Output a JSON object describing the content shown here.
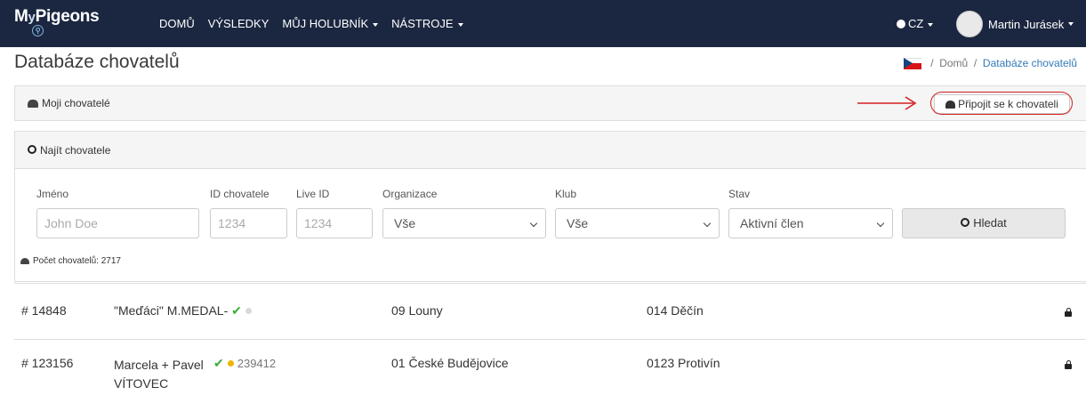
{
  "nav": {
    "logo": "MyPigeons",
    "logo_my": "M",
    "logo_y": "y",
    "logo_rest": "Pigeons",
    "items": [
      {
        "label": "DOMŮ"
      },
      {
        "label": "VÝSLEDKY"
      },
      {
        "label": "MŮJ HOLUBNÍK"
      },
      {
        "label": "NÁSTROJE"
      }
    ],
    "language": "CZ",
    "user": "Martin Jurásek"
  },
  "page": {
    "title": "Databáze chovatelů",
    "breadcrumb": [
      "Domů",
      "Databáze chovatelů"
    ],
    "breadcrumb_sep": "/"
  },
  "my_breeders": {
    "title": "Moji chovatelé",
    "join_button": "Připojit se k chovateli"
  },
  "search": {
    "title": "Najít chovatele",
    "fields": {
      "name": {
        "label": "Jméno",
        "placeholder": "John Doe"
      },
      "breeder_id": {
        "label": "ID chovatele",
        "placeholder": "1234"
      },
      "live_id": {
        "label": "Live ID",
        "placeholder": "1234"
      },
      "organization": {
        "label": "Organizace",
        "value": "Vše"
      },
      "club": {
        "label": "Klub",
        "value": "Vše"
      },
      "status": {
        "label": "Stav",
        "value": "Aktivní člen"
      }
    },
    "button": "Hledat",
    "count_label": "Počet chovatelů: 2717"
  },
  "results": [
    {
      "id": "# 14848",
      "name": "\"Meďáci\" M.MEDAL-",
      "verified": true,
      "dot_color": "#d9d9d9",
      "live_id": "",
      "organization": "09 Louny",
      "club": "014 Děčín"
    },
    {
      "id": "# 123156",
      "name": "Marcela + Pavel VÍTOVEC",
      "name_line1": "Marcela + Pavel",
      "name_line2": "VÍTOVEC",
      "verified": true,
      "dot_color": "#f0b400",
      "live_id": "239412",
      "organization": "01 České Budějovice",
      "club": "0123 Protivín"
    }
  ],
  "colors": {
    "navbar": "#1b2740",
    "annotation": "#d42020",
    "check": "#3aad3a"
  }
}
